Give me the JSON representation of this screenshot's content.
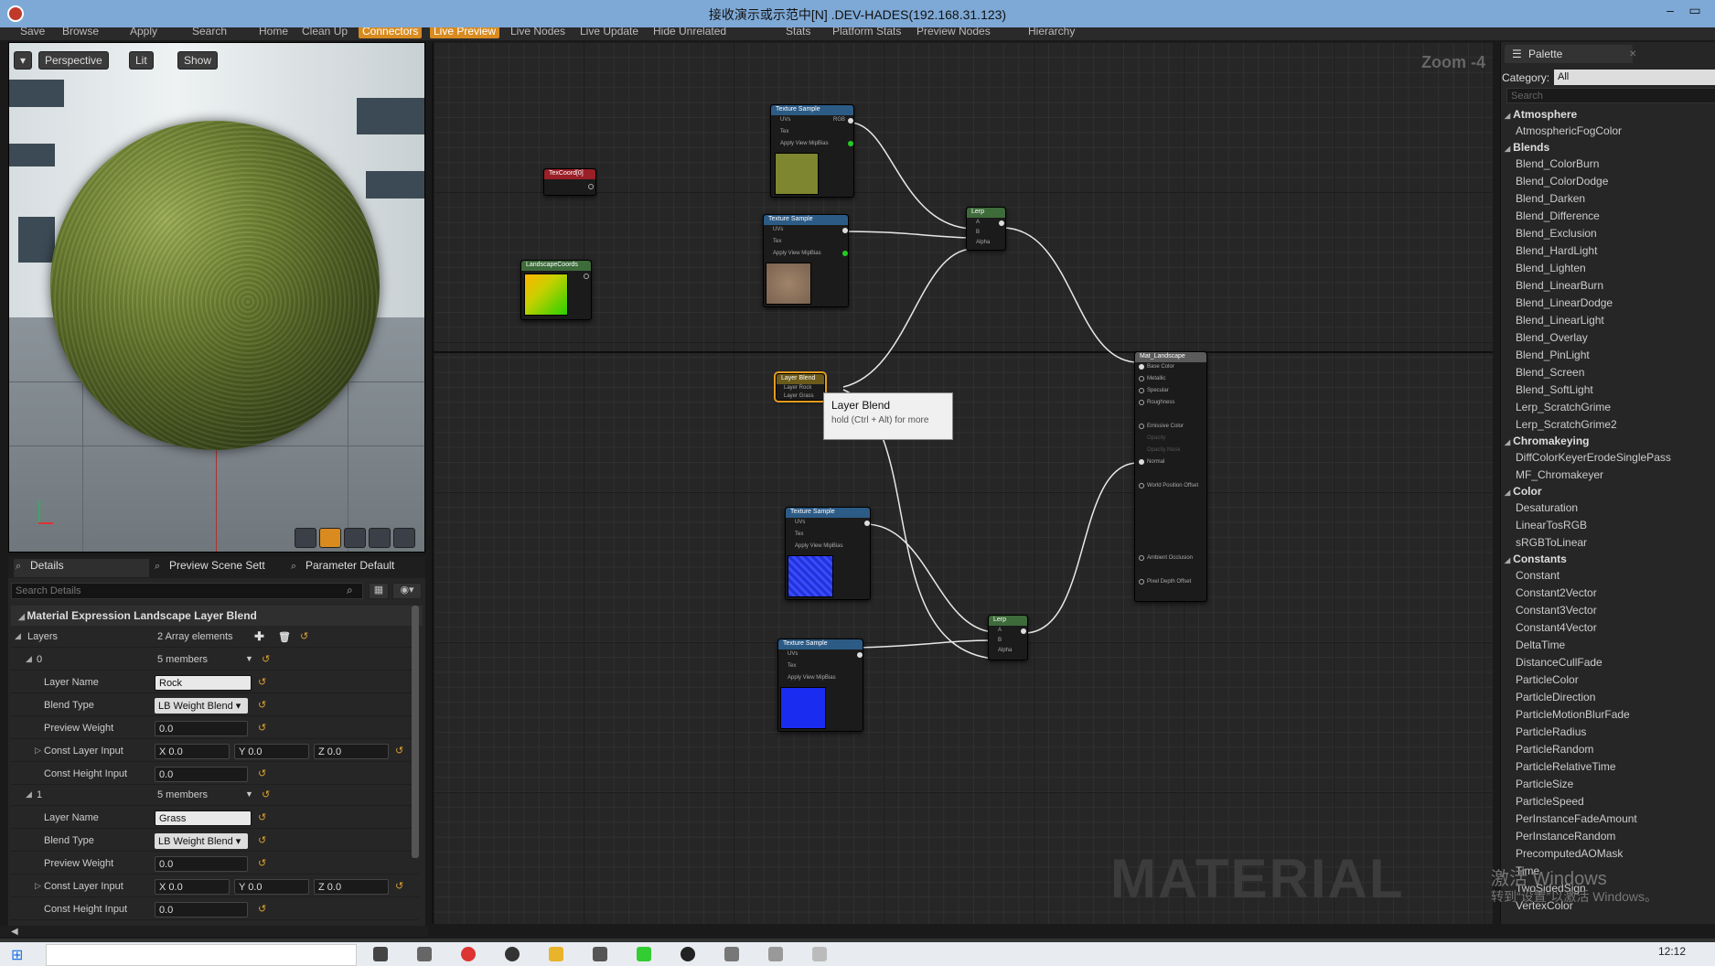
{
  "window": {
    "title": "接收演示或示范中[N] .DEV-HADES(192.168.31.123)",
    "minimize": "–",
    "maximize": "▭"
  },
  "toolbar": [
    {
      "label": "Save",
      "active": false
    },
    {
      "label": "Browse",
      "active": false
    },
    {
      "label": "Apply",
      "active": false
    },
    {
      "label": "Search",
      "active": false
    },
    {
      "label": "Home",
      "active": false
    },
    {
      "label": "Clean Up",
      "active": false
    },
    {
      "label": "Connectors",
      "active": true
    },
    {
      "label": "Live Preview",
      "active": true
    },
    {
      "label": "Live Nodes",
      "active": false
    },
    {
      "label": "Live Update",
      "active": false
    },
    {
      "label": "Hide Unrelated",
      "active": false
    },
    {
      "label": "Stats",
      "active": false
    },
    {
      "label": "Platform Stats",
      "active": false
    },
    {
      "label": "Preview Nodes",
      "active": false
    },
    {
      "label": "Hierarchy",
      "active": false
    }
  ],
  "viewport": {
    "perspective": "Perspective",
    "lit": "Lit",
    "show": "Show",
    "axis_z": "Z",
    "axis_x": "X"
  },
  "details": {
    "tabs": [
      "Details",
      "Preview Scene Sett",
      "Parameter Default"
    ],
    "search_placeholder": "Search Details",
    "section": "Material Expression Landscape Layer Blend",
    "layers_label": "Layers",
    "layers_value": "2 Array elements",
    "layers": [
      {
        "index": "0",
        "members": "5 members",
        "layer_name_label": "Layer Name",
        "layer_name": "Rock",
        "blend_type_label": "Blend Type",
        "blend_type": "LB Weight Blend",
        "preview_weight_label": "Preview Weight",
        "preview_weight": "0.0",
        "const_layer_label": "Const Layer Input",
        "x": "X  0.0",
        "y": "Y  0.0",
        "z": "Z  0.0",
        "const_height_label": "Const Height Input",
        "const_height": "0.0"
      },
      {
        "index": "1",
        "members": "5 members",
        "layer_name_label": "Layer Name",
        "layer_name": "Grass",
        "blend_type_label": "Blend Type",
        "blend_type": "LB Weight Blend",
        "preview_weight_label": "Preview Weight",
        "preview_weight": "0.0",
        "const_layer_label": "Const Layer Input",
        "x": "X  0.0",
        "y": "Y  0.0",
        "z": "Z  0.0",
        "const_height_label": "Const Height Input",
        "const_height": "0.0"
      }
    ]
  },
  "graph": {
    "zoom": "Zoom -4",
    "watermark": "MATERIAL",
    "nodes": {
      "texcoord": "TexCoord[0]",
      "landscape": "LandscapeCoords",
      "tex1": "Texture Sample",
      "tex2": "Texture Sample",
      "tex3": "Texture Sample",
      "tex4": "Texture Sample",
      "lerp1": "Lerp",
      "lerp2": "Lerp",
      "layerblend": "Layer Blend",
      "matout": "Mat_Landscape"
    },
    "tex_pins_left": [
      "UVs",
      "Tex",
      "Apply View MipBias"
    ],
    "tex_pins_right": [
      "RGB",
      "R",
      "G",
      "B",
      "A",
      "RGBA"
    ],
    "lerp_pins": [
      "A",
      "B",
      "Alpha"
    ],
    "layerblend_pins": [
      "Layer Rock",
      "Layer Grass"
    ],
    "mat_pins": [
      "Base Color",
      "Metallic",
      "Specular",
      "Roughness",
      "Emissive Color",
      "Opacity",
      "Opacity Mask",
      "Normal",
      "World Position Offset",
      "Ambient Occlusion",
      "Pixel Depth Offset"
    ],
    "tooltip_title": "Layer Blend",
    "tooltip_sub": "hold (Ctrl + Alt) for more"
  },
  "palette": {
    "tab": "Palette",
    "category_label": "Category:",
    "category_value": "All",
    "search_placeholder": "Search",
    "groups": [
      {
        "name": "Atmosphere",
        "items": [
          "AtmosphericFogColor"
        ]
      },
      {
        "name": "Blends",
        "items": [
          "Blend_ColorBurn",
          "Blend_ColorDodge",
          "Blend_Darken",
          "Blend_Difference",
          "Blend_Exclusion",
          "Blend_HardLight",
          "Blend_Lighten",
          "Blend_LinearBurn",
          "Blend_LinearDodge",
          "Blend_LinearLight",
          "Blend_Overlay",
          "Blend_PinLight",
          "Blend_Screen",
          "Blend_SoftLight",
          "Lerp_ScratchGrime",
          "Lerp_ScratchGrime2"
        ]
      },
      {
        "name": "Chromakeying",
        "items": [
          "DiffColorKeyerErodeSinglePass",
          "MF_Chromakeyer"
        ]
      },
      {
        "name": "Color",
        "items": [
          "Desaturation",
          "LinearTosRGB",
          "sRGBToLinear"
        ]
      },
      {
        "name": "Constants",
        "items": [
          "Constant",
          "Constant2Vector",
          "Constant3Vector",
          "Constant4Vector",
          "DeltaTime",
          "DistanceCullFade",
          "ParticleColor",
          "ParticleDirection",
          "ParticleMotionBlurFade",
          "ParticleRadius",
          "ParticleRandom",
          "ParticleRelativeTime",
          "ParticleSize",
          "ParticleSpeed",
          "PerInstanceFadeAmount",
          "PerInstanceRandom",
          "PrecomputedAOMask",
          "Time",
          "TwoSidedSign",
          "VertexColor"
        ]
      }
    ],
    "os_watermark_1": "激活 Windows",
    "os_watermark_2": "转到“设置”以激活 Windows。"
  },
  "taskbar": {
    "clock": "12:12"
  },
  "colors": {
    "accent": "#d98b1f",
    "title_bar": "#7ea9d6",
    "texture_header": "#2c5b86"
  }
}
